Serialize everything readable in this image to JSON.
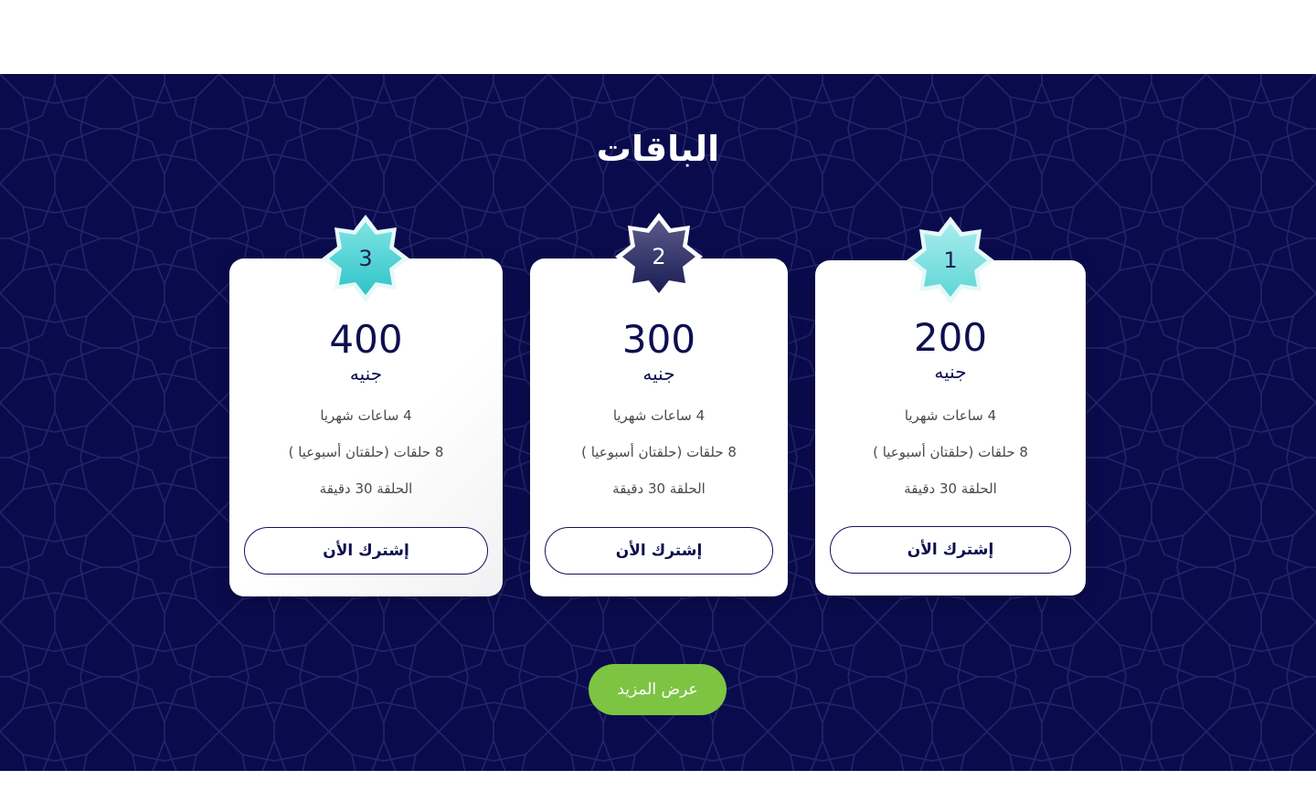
{
  "section": {
    "title": "الباقات",
    "background_color": "#0a0b4d",
    "more_button_label": "عرض المزيد",
    "more_button_color": "#7dc443"
  },
  "plans": [
    {
      "number": "1",
      "price": "200",
      "currency": "جنيه",
      "features": [
        "4 ساعات شهريا",
        "8 حلقات (حلقتان أسبوعيا )",
        "الحلقة 30 دقيقة"
      ],
      "button_label": "إشترك الأن",
      "badge_style": "light-teal"
    },
    {
      "number": "2",
      "price": "300",
      "currency": "جنيه",
      "features": [
        "4 ساعات شهريا",
        "8 حلقات (حلقتان أسبوعيا )",
        "الحلقة 30 دقيقة"
      ],
      "button_label": "إشترك الأن",
      "badge_style": "dark-navy"
    },
    {
      "number": "3",
      "price": "400",
      "currency": "جنيه",
      "features": [
        "4 ساعات شهريا",
        "8 حلقات (حلقتان أسبوعيا )",
        "الحلقة 30 دقيقة"
      ],
      "button_label": "إشترك الأن",
      "badge_style": "teal"
    }
  ],
  "icons": {
    "badge_shape": "eight-point-star-icon",
    "background_pattern": "islamic-geometric-pattern"
  }
}
